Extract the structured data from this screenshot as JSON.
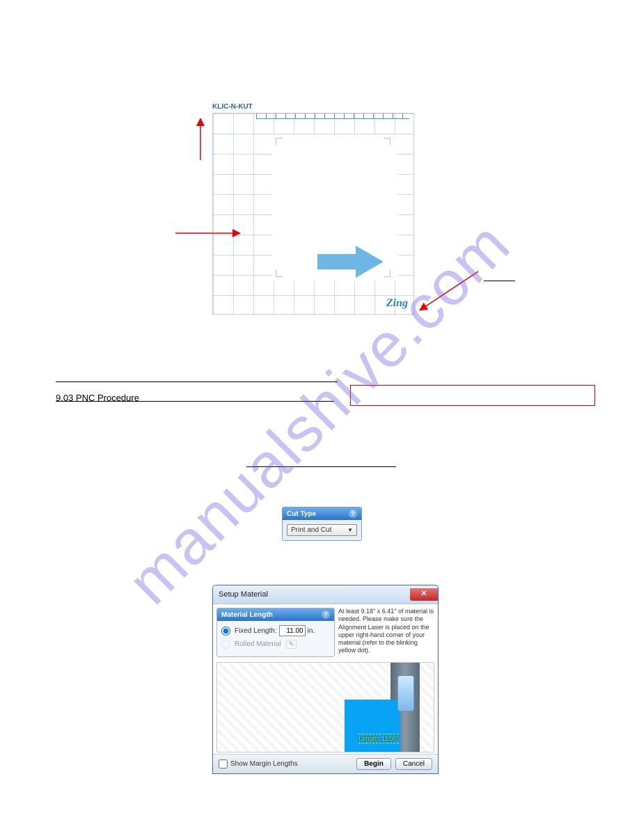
{
  "mat": {
    "brand": "KLIC-N-KUT",
    "logo": "Zing"
  },
  "section": {
    "title": "9.03 PNC Procedure"
  },
  "cutTypePanel": {
    "header": "Cut Type",
    "selected": "Print and Cut"
  },
  "dialog": {
    "title": "Setup Material",
    "materialLength": {
      "header": "Material Length",
      "fixedLabel": "Fixed Length:",
      "fixedValue": "11.00",
      "unit": "in.",
      "rolledLabel": "Rolled Material"
    },
    "instructions": "At least 9.18\" x 6.41\" of material is needed. Please make sure the Alignment Laser is placed on the upper right-hand corner of your material (refer to the blinking yellow dot).",
    "lengthOverlay": "Length: 11.00\"",
    "showMargin": "Show Margin Lengths",
    "beginBtn": "Begin",
    "cancelBtn": "Cancel"
  }
}
